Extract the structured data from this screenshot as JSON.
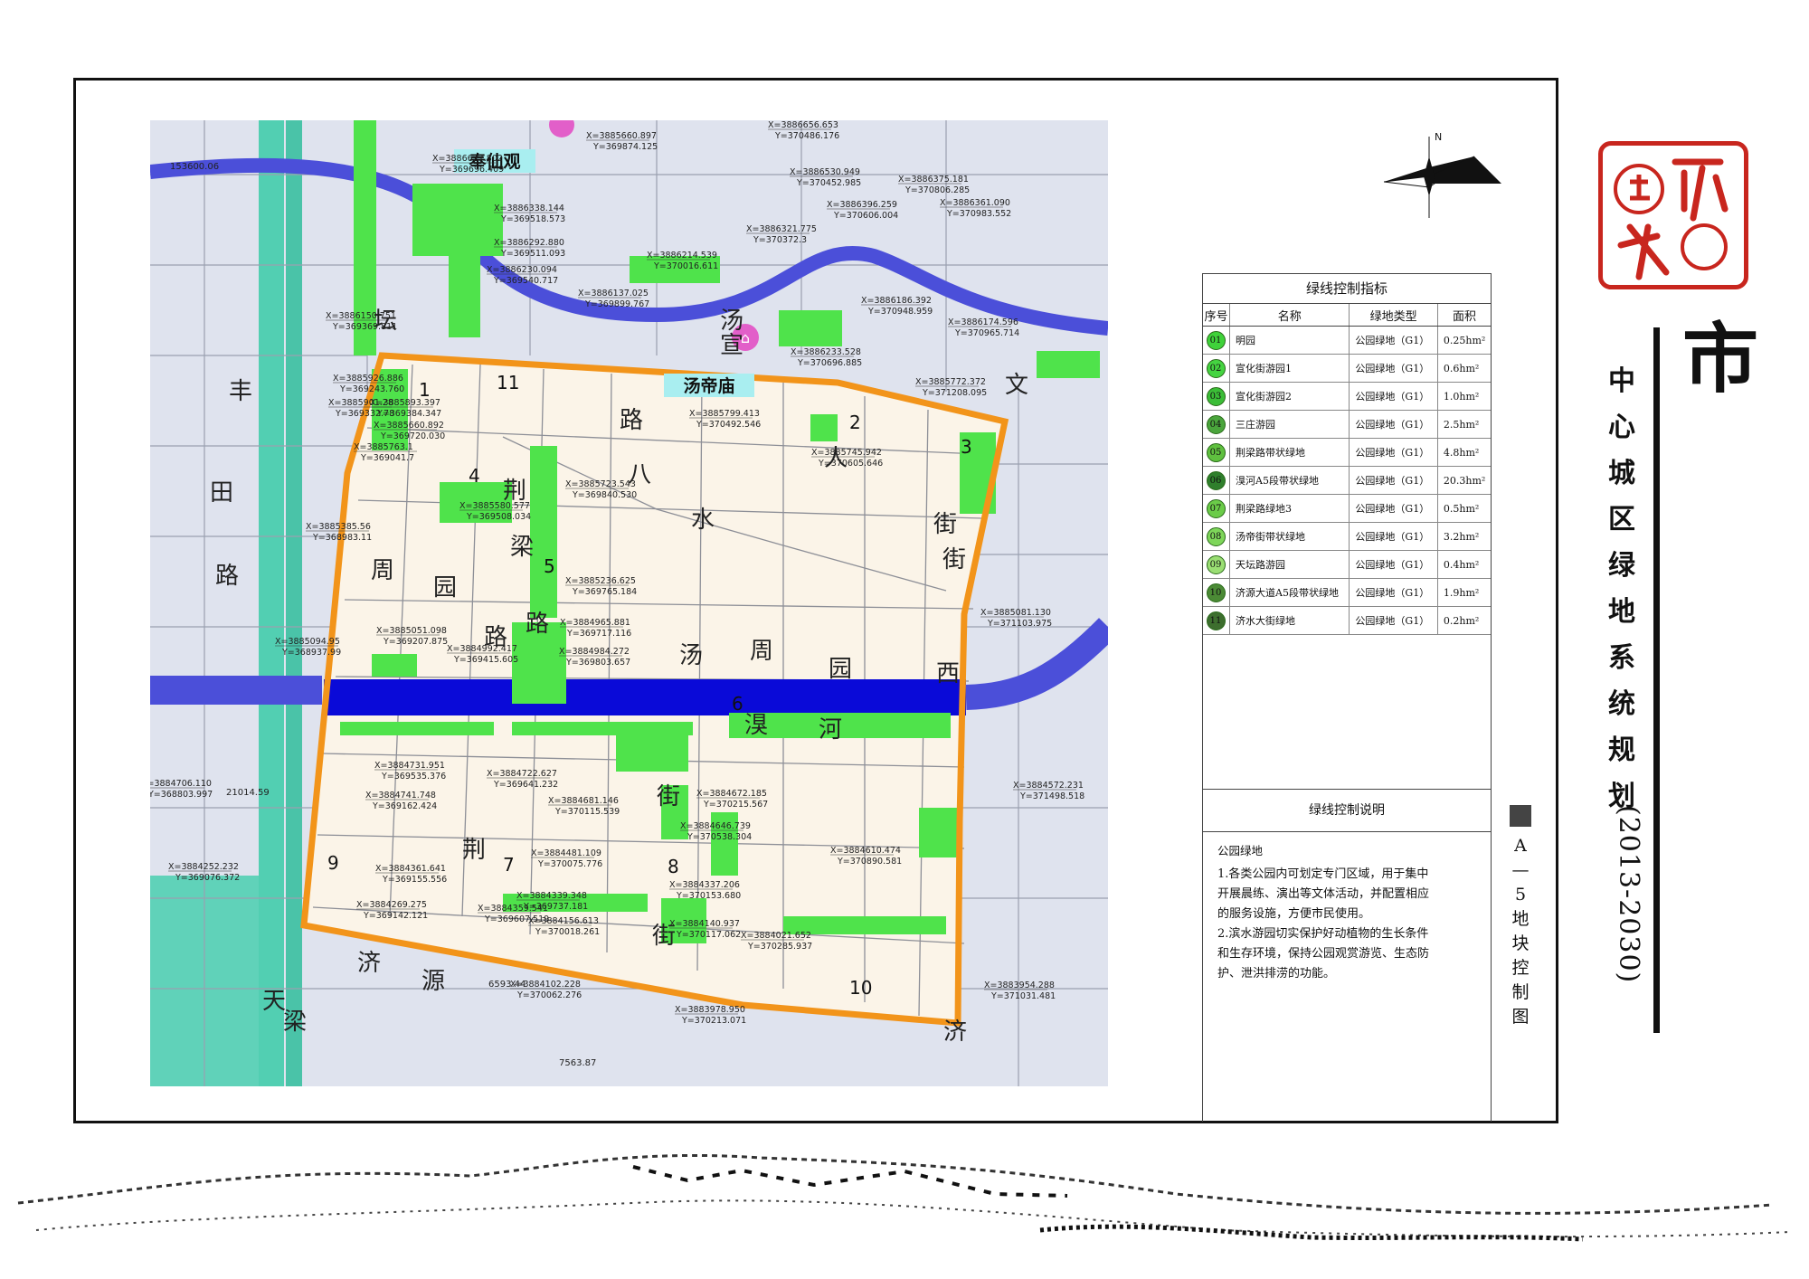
{
  "map": {
    "places": [
      {
        "name": "奉仙观"
      },
      {
        "name": "汤帝庙"
      }
    ],
    "parcel_numbers": [
      "1",
      "2",
      "3",
      "4",
      "5",
      "6",
      "7",
      "8",
      "9",
      "10",
      "11"
    ],
    "road_chars": [
      "荆",
      "梁",
      "路",
      "周",
      "园",
      "路",
      "汤",
      "周",
      "园",
      "路",
      "八",
      "水",
      "人",
      "街",
      "街",
      "湨",
      "河",
      "街",
      "荆",
      "街",
      "丰",
      "田",
      "路",
      "天",
      "梁",
      "济",
      "源",
      "济",
      "宣",
      "坛",
      "文",
      "西",
      "汤"
    ],
    "coordinates": [
      {
        "x": "X=3886627.802",
        "y": "Y=369696.409"
      },
      {
        "x": "X=3885660.897",
        "y": "Y=369874.125"
      },
      {
        "x": "X=3886656.653",
        "y": "Y=370486.176"
      },
      {
        "x": "X=3886530.949",
        "y": "Y=370452.985"
      },
      {
        "x": "X=3886375.181",
        "y": "Y=370806.285"
      },
      {
        "x": "X=3886396.259",
        "y": "Y=370606.004"
      },
      {
        "x": "X=3886361.090",
        "y": "Y=370983.552"
      },
      {
        "x": "X=3886338.144",
        "y": "Y=369518.573"
      },
      {
        "x": "X=3886321.775",
        "y": "Y=370372.3"
      },
      {
        "x": "X=3886292.880",
        "y": "Y=369511.093"
      },
      {
        "x": "X=3886230.094",
        "y": "Y=369540.717"
      },
      {
        "x": "X=3886214.539",
        "y": "Y=370016.611"
      },
      {
        "x": "X=3886137.025",
        "y": "Y=369899.767"
      },
      {
        "x": "X=3886186.392",
        "y": "Y=370948.959"
      },
      {
        "x": "X=3886150.751",
        "y": "Y=369369.811"
      },
      {
        "x": "X=3886174.596",
        "y": "Y=370965.714"
      },
      {
        "x": "X=3886233.528",
        "y": "Y=370696.885"
      },
      {
        "x": "X=3885926.886",
        "y": "Y=369243.760"
      },
      {
        "x": "X=3885901.28",
        "y": "Y=369332.78"
      },
      {
        "x": "X=3885772.372",
        "y": "Y=371208.095"
      },
      {
        "x": "X=3885893.397",
        "y": "Y=369384.347"
      },
      {
        "x": "X=3885660.892",
        "y": "Y=369720.030"
      },
      {
        "x": "X=3885799.413",
        "y": "Y=370492.546"
      },
      {
        "x": "X=3885763.1",
        "y": "Y=369041.7"
      },
      {
        "x": "X=3885745.942",
        "y": "Y=370605.646"
      },
      {
        "x": "X=3885723.543",
        "y": "Y=369840.530"
      },
      {
        "x": "X=3885580.577",
        "y": "Y=369508.034"
      },
      {
        "x": "X=3885385.56",
        "y": "Y=368983.11"
      },
      {
        "x": "X=3885236.625",
        "y": "Y=369765.184"
      },
      {
        "x": "X=3885081.130",
        "y": "Y=371103.975"
      },
      {
        "x": "X=3884965.881",
        "y": "Y=369717.116"
      },
      {
        "x": "X=3885051.098",
        "y": "Y=369207.875"
      },
      {
        "x": "X=3885094.95",
        "y": "Y=368937.99"
      },
      {
        "x": "X=3884992.417",
        "y": "Y=369415.605"
      },
      {
        "x": "X=3884984.272",
        "y": "Y=369803.657"
      },
      {
        "x": "X=3884731.951",
        "y": "Y=369535.376"
      },
      {
        "x": "X=3884722.627",
        "y": "Y=369641.232"
      },
      {
        "x": "X=3884741.748",
        "y": "Y=369162.424"
      },
      {
        "x": "X=3884681.146",
        "y": "Y=370115.539"
      },
      {
        "x": "X=3884672.185",
        "y": "Y=370215.567"
      },
      {
        "x": "X=3884646.739",
        "y": "Y=370538.304"
      },
      {
        "x": "X=3884572.231",
        "y": "Y=371498.518"
      },
      {
        "x": "X=3884706.110",
        "y": "Y=368803.997"
      },
      {
        "x": "X=3884481.109",
        "y": "Y=370075.776"
      },
      {
        "x": "X=3884610.474",
        "y": "Y=370890.581"
      },
      {
        "x": "X=3884361.641",
        "y": "Y=369155.556"
      },
      {
        "x": "X=3884252.232",
        "y": "Y=369076.372"
      },
      {
        "x": "X=3884337.206",
        "y": "Y=370153.680"
      },
      {
        "x": "X=3884339.348",
        "y": "Y=369737.181"
      },
      {
        "x": "X=3884269.275",
        "y": "Y=369142.121"
      },
      {
        "x": "X=3884359.541",
        "y": "Y=369607.519"
      },
      {
        "x": "X=3884156.613",
        "y": "Y=370018.261"
      },
      {
        "x": "X=3884140.937",
        "y": "Y=370117.062"
      },
      {
        "x": "X=3884021.652",
        "y": "Y=370285.937"
      },
      {
        "x": "X=3883954.288",
        "y": "Y=371031.481"
      },
      {
        "x": "X=3884102.228",
        "y": "Y=370062.276"
      },
      {
        "x": "X=3883978.950",
        "y": "Y=370213.071"
      }
    ],
    "elevations": [
      "153600.06",
      "21014.59",
      "6593.44",
      "7563.87"
    ],
    "north_label": "N"
  },
  "table": {
    "title": "绿线控制指标",
    "headers": [
      "序号",
      "名称",
      "绿地类型",
      "面积"
    ],
    "rows": [
      {
        "num": "01",
        "name": "明园",
        "type": "公园绿地（G1）",
        "area": "0.25hm²",
        "color": "#3fd23a"
      },
      {
        "num": "02",
        "name": "宣化街游园1",
        "type": "公园绿地（G1）",
        "area": "0.6hm²",
        "color": "#45d441"
      },
      {
        "num": "03",
        "name": "宣化街游园2",
        "type": "公园绿地（G1）",
        "area": "1.0hm²",
        "color": "#3bbd37"
      },
      {
        "num": "04",
        "name": "三庄游园",
        "type": "公园绿地（G1）",
        "area": "2.5hm²",
        "color": "#4aa53c"
      },
      {
        "num": "05",
        "name": "荆梁路带状绿地",
        "type": "公园绿地（G1）",
        "area": "4.8hm²",
        "color": "#5fc03f"
      },
      {
        "num": "06",
        "name": "湨河A5段带状绿地",
        "type": "公园绿地（G1）",
        "area": "20.3hm²",
        "color": "#2f7f2c"
      },
      {
        "num": "07",
        "name": "荆梁路绿地3",
        "type": "公园绿地（G1）",
        "area": "0.5hm²",
        "color": "#6bcc49"
      },
      {
        "num": "08",
        "name": "汤帝街带状绿地",
        "type": "公园绿地（G1）",
        "area": "3.2hm²",
        "color": "#7ed65a"
      },
      {
        "num": "09",
        "name": "天坛路游园",
        "type": "公园绿地（G1）",
        "area": "0.4hm²",
        "color": "#9ade73"
      },
      {
        "num": "10",
        "name": "济源大道A5段带状绿地",
        "type": "公园绿地（G1）",
        "area": "1.9hm²",
        "color": "#4b8a35"
      },
      {
        "num": "11",
        "name": "济水大街绿地",
        "type": "公园绿地（G1）",
        "area": "0.2hm²",
        "color": "#3d6e2e"
      }
    ]
  },
  "notes": {
    "title": "绿线控制说明",
    "subtitle": "公园绿地",
    "lines": [
      "1.各类公园内可划定专门区域，用于集中",
      "开展晨练、演出等文体活动，并配置相应",
      "的服务设施，方便市民使用。",
      "2.滨水游园切实保护好动植物的生长条件",
      "和生存环境，保持公园观赏游览、生态防",
      "护、泄洪排涝的功能。"
    ]
  },
  "title": {
    "big_char": "市",
    "main": "中心城区绿地系统规划",
    "years": "(2013-2030)",
    "sheet": "A—5地块控制图"
  },
  "seal": {
    "text": "济源印"
  }
}
